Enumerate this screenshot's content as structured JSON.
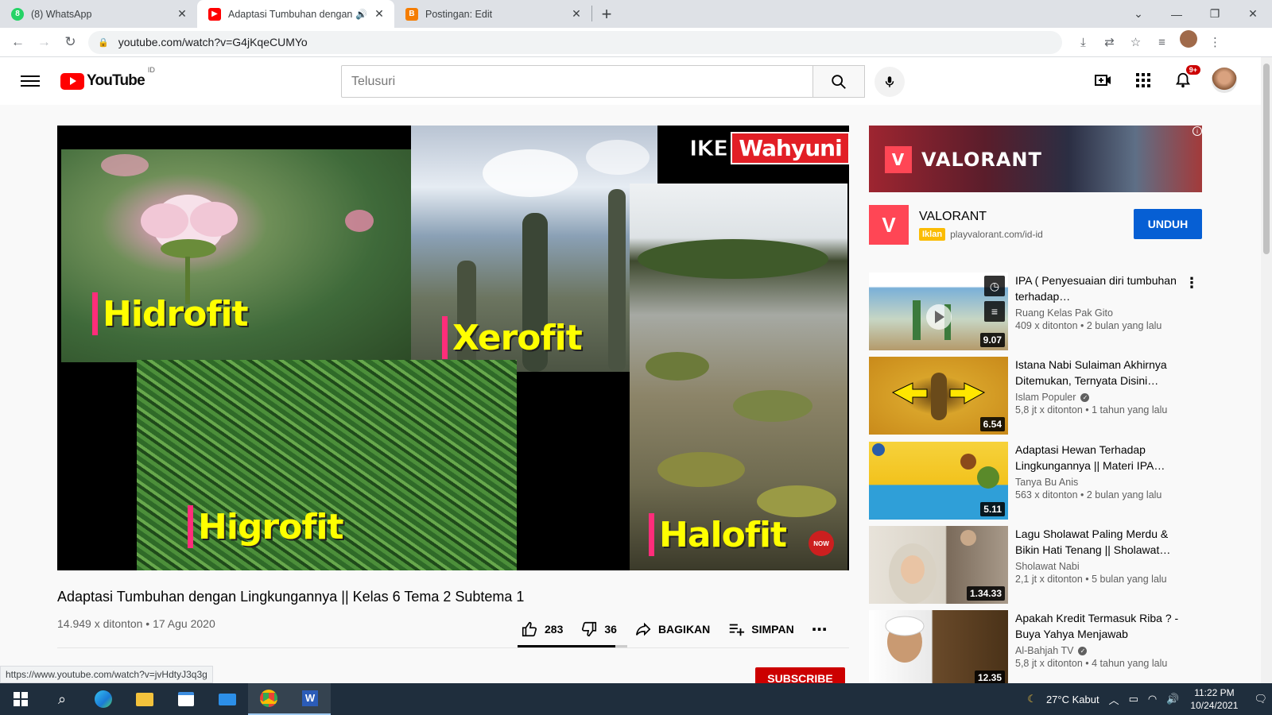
{
  "browser": {
    "tabs": [
      {
        "title": "(8) WhatsApp",
        "icon": "whatsapp-icon",
        "color": "#25d366",
        "active": false
      },
      {
        "title": "Adaptasi Tumbuhan dengan",
        "icon": "youtube-icon",
        "color": "#ff0000",
        "active": true
      },
      {
        "title": "Postingan: Edit",
        "icon": "blogger-icon",
        "color": "#f57d00",
        "active": false
      }
    ],
    "url": "youtube.com/watch?v=G4jKqeCUMYo",
    "status_url": "https://www.youtube.com/watch?v=jvHdtyJ3q3g"
  },
  "youtube": {
    "logo_text": "YouTube",
    "country_code": "ID",
    "search_placeholder": "Telusuri",
    "notification_count": "9+"
  },
  "video": {
    "overlay_labels": [
      "Hidrofit",
      "Xerofit",
      "Higrofit",
      "Halofit"
    ],
    "brand_part1": "IKE",
    "brand_part2": "Wahyuni",
    "subscribe_badge": "NOW",
    "title": "Adaptasi Tumbuhan dengan Lingkungannya || Kelas 6 Tema 2 Subtema 1",
    "views": "14.949 x ditonton",
    "date": "17 Agu 2020",
    "likes": "283",
    "dislikes": "36",
    "like_ratio": 0.89,
    "share_label": "BAGIKAN",
    "save_label": "SIMPAN",
    "subscribe_label": "SUBSCRIBE"
  },
  "ad": {
    "banner_text": "VALORANT",
    "name": "VALORANT",
    "badge": "Iklan",
    "url": "playvalorant.com/id-id",
    "cta": "UNDUH"
  },
  "recommendations": [
    {
      "title": "IPA ( Penyesuaian diri tumbuhan terhadap…",
      "channel": "Ruang Kelas Pak Gito",
      "verified": false,
      "stats": "409 x ditonton • 2 bulan yang lalu",
      "duration": "9.07"
    },
    {
      "title": "Istana Nabi Sulaiman Akhirnya Ditemukan, Ternyata Disini…",
      "channel": "Islam Populer",
      "verified": true,
      "stats": "5,8 jt x ditonton • 1 tahun yang lalu",
      "duration": "6.54"
    },
    {
      "title": "Adaptasi Hewan Terhadap Lingkungannya || Materi IPA…",
      "channel": "Tanya Bu Anis",
      "verified": false,
      "stats": "563 x ditonton • 2 bulan yang lalu",
      "duration": "5.11"
    },
    {
      "title": "Lagu Sholawat Paling Merdu & Bikin Hati Tenang || Sholawat…",
      "channel": "Sholawat Nabi",
      "verified": false,
      "stats": "2,1 jt x ditonton • 5 bulan yang lalu",
      "duration": "1.34.33"
    },
    {
      "title": "Apakah Kredit Termasuk Riba ? - Buya Yahya Menjawab",
      "channel": "Al-Bahjah TV",
      "verified": true,
      "stats": "5,8 jt x ditonton • 4 tahun yang lalu",
      "duration": "12.35"
    }
  ],
  "taskbar": {
    "weather": "27°C  Kabut",
    "time": "11:22 PM",
    "date": "10/24/2021"
  }
}
